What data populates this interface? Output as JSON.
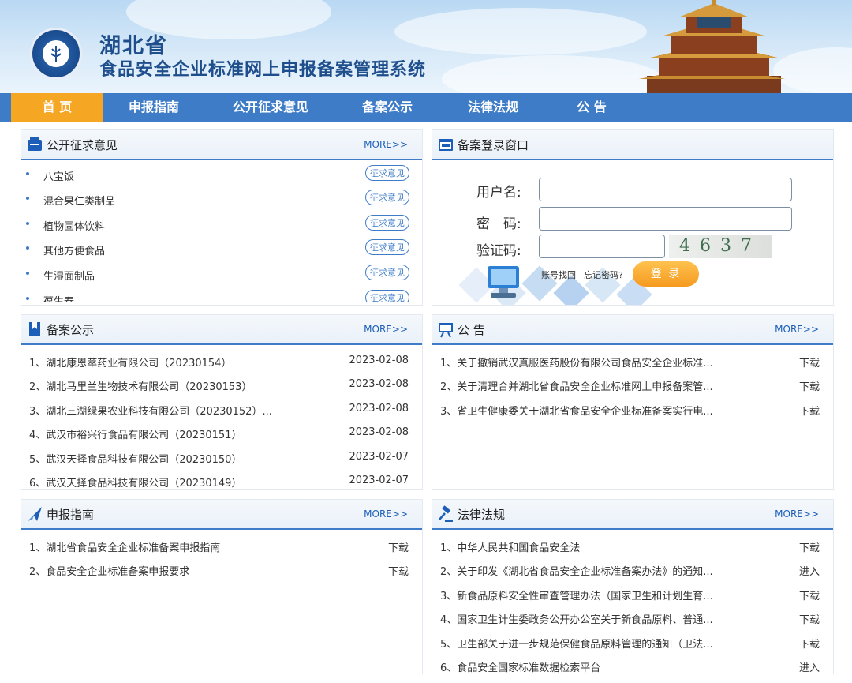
{
  "header": {
    "title_province": "湖北省",
    "title_system": "食品安全企业标准网上申报备案管理系统"
  },
  "nav": {
    "items": [
      {
        "label": "首 页",
        "active": true
      },
      {
        "label": "申报指南"
      },
      {
        "label": "公开征求意见"
      },
      {
        "label": "备案公示"
      },
      {
        "label": "法律法规"
      },
      {
        "label": "公 告"
      }
    ]
  },
  "panels": {
    "consultation": {
      "title": "公开征求意见",
      "more": "MORE>>",
      "button_label": "征求意见",
      "items": [
        "八宝饭",
        "混合果仁类制品",
        "植物固体饮料",
        "其他方便食品",
        "生湿面制品",
        "葆生泰"
      ]
    },
    "login": {
      "title": "备案登录窗口",
      "username_label": "用户名:",
      "password_label": "密　码:",
      "captcha_label": "验证码:",
      "captcha_value": "4637",
      "account_recover": "账号找回",
      "forgot_password": "忘记密码?",
      "login_button": "登 录"
    },
    "filing": {
      "title": "备案公示",
      "more": "MORE>>",
      "items": [
        {
          "text": "1、湖北康恩萃药业有限公司（20230154）",
          "date": "2023-02-08"
        },
        {
          "text": "2、湖北马里兰生物技术有限公司（20230153）",
          "date": "2023-02-08"
        },
        {
          "text": "3、湖北三湖绿果农业科技有限公司（20230152）...",
          "date": "2023-02-08"
        },
        {
          "text": "4、武汉市裕兴行食品有限公司（20230151）",
          "date": "2023-02-08"
        },
        {
          "text": "5、武汉天择食品科技有限公司（20230150）",
          "date": "2023-02-07"
        },
        {
          "text": "6、武汉天择食品科技有限公司（20230149）",
          "date": "2023-02-07"
        }
      ]
    },
    "notice": {
      "title": "公 告",
      "more": "MORE>>",
      "items": [
        {
          "text": "1、关于撤销武汉真服医药股份有限公司食品安全企业标准...",
          "action": "下载"
        },
        {
          "text": "2、关于清理合并湖北省食品安全企业标准网上申报备案管...",
          "action": "下载"
        },
        {
          "text": "3、省卫生健康委关于湖北省食品安全企业标准备案实行电...",
          "action": "下载"
        }
      ]
    },
    "guide": {
      "title": "申报指南",
      "more": "MORE>>",
      "items": [
        {
          "text": "1、湖北省食品安全企业标准备案申报指南",
          "action": "下载"
        },
        {
          "text": "2、食品安全企业标准备案申报要求",
          "action": "下载"
        }
      ]
    },
    "law": {
      "title": "法律法规",
      "more": "MORE>>",
      "items": [
        {
          "text": "1、中华人民共和国食品安全法",
          "action": "下载"
        },
        {
          "text": "2、关于印发《湖北省食品安全企业标准备案办法》的通知...",
          "action": "进入"
        },
        {
          "text": "3、新食品原料安全性审查管理办法（国家卫生和计划生育...",
          "action": "下载"
        },
        {
          "text": "4、国家卫生计生委政务公开办公室关于新食品原料、普通...",
          "action": "下载"
        },
        {
          "text": "5、卫生部关于进一步规范保健食品原料管理的通知（卫法...",
          "action": "下载"
        },
        {
          "text": "6、食品安全国家标准数据检索平台",
          "action": "进入"
        }
      ]
    }
  }
}
